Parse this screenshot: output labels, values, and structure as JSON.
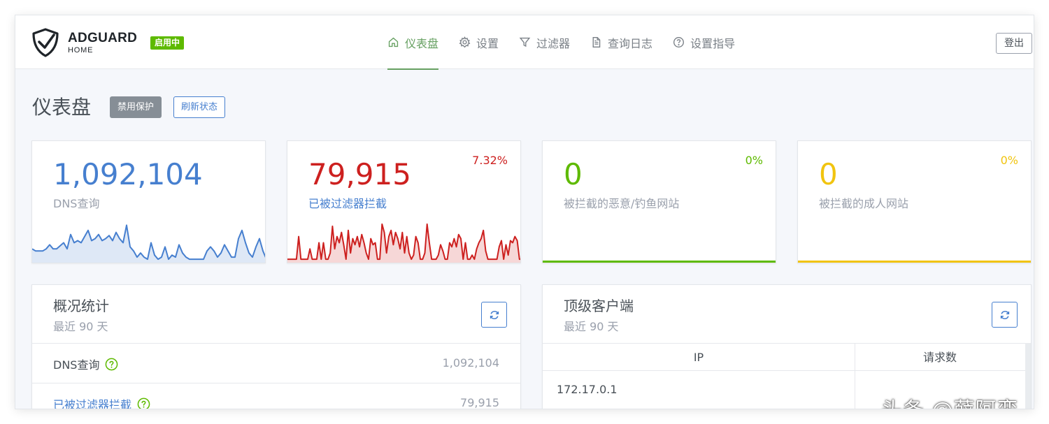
{
  "header": {
    "brand_name": "ADGUARD",
    "brand_sub": "HOME",
    "status_badge": "启用中",
    "logout": "登出",
    "nav": [
      {
        "label": "仪表盘",
        "icon": "home-icon",
        "active": true
      },
      {
        "label": "设置",
        "icon": "gear-icon",
        "active": false
      },
      {
        "label": "过滤器",
        "icon": "filter-icon",
        "active": false
      },
      {
        "label": "查询日志",
        "icon": "document-icon",
        "active": false
      },
      {
        "label": "设置指导",
        "icon": "help-circle-icon",
        "active": false
      }
    ]
  },
  "page": {
    "title": "仪表盘",
    "disable_protection": "禁用保护",
    "refresh_status": "刷新状态"
  },
  "cards": [
    {
      "value": "1,092,104",
      "label": "DNS查询",
      "percent": "",
      "color": "#467fcf"
    },
    {
      "value": "79,915",
      "label": "已被过滤器拦截",
      "percent": "7.32%",
      "color": "#cd201f"
    },
    {
      "value": "0",
      "label": "被拦截的恶意/钓鱼网站",
      "percent": "0%",
      "color": "#5eba00"
    },
    {
      "value": "0",
      "label": "被拦截的成人网站",
      "percent": "0%",
      "color": "#f1c40f"
    }
  ],
  "chart_data": [
    {
      "type": "area",
      "series": [
        {
          "values": [
            12,
            10,
            10,
            10,
            12,
            16,
            12,
            12,
            15,
            18,
            12,
            26,
            18,
            20,
            18,
            24,
            30,
            20,
            22,
            26,
            20,
            22,
            25,
            20,
            28,
            22,
            18,
            35,
            14,
            10,
            4,
            8,
            4,
            2,
            18,
            6,
            2,
            4,
            14,
            2,
            6,
            4,
            16,
            8,
            4,
            2,
            2,
            2,
            2,
            2,
            10,
            14,
            10,
            4,
            8,
            16,
            10,
            4,
            4,
            22,
            30,
            18,
            8,
            4,
            14,
            22,
            10,
            2
          ]
        }
      ],
      "color": "#467fcf"
    },
    {
      "type": "area",
      "series": [
        {
          "values": [
            2,
            2,
            2,
            2,
            2,
            24,
            2,
            2,
            2,
            2,
            12,
            2,
            2,
            2,
            18,
            2,
            18,
            2,
            2,
            8,
            34,
            12,
            24,
            18,
            28,
            16,
            2,
            30,
            8,
            22,
            16,
            24,
            14,
            26,
            18,
            8,
            2,
            22,
            16,
            18,
            2,
            2,
            36,
            28,
            8,
            24,
            30,
            16,
            28,
            22,
            12,
            28,
            8,
            24,
            8,
            2,
            6,
            24,
            18,
            2,
            2,
            8,
            36,
            18,
            2,
            2,
            2,
            6,
            16,
            10,
            2,
            2,
            18,
            14,
            22,
            14,
            26,
            22,
            2,
            18,
            2,
            2,
            6,
            2,
            12,
            18,
            22,
            30,
            10,
            2,
            2,
            2,
            2,
            2,
            14,
            20,
            2,
            16,
            6,
            20,
            18,
            24,
            20,
            2,
            2
          ]
        }
      ],
      "color": "#cd201f"
    }
  ],
  "overview": {
    "title": "概况统计",
    "subtitle": "最近 90 天",
    "rows": [
      {
        "label": "DNS查询",
        "value": "1,092,104"
      },
      {
        "label": "已被过滤器拦截",
        "value": "79,915"
      }
    ]
  },
  "top_clients": {
    "title": "顶级客户端",
    "subtitle": "最近 90 天",
    "columns": [
      "IP",
      "请求数"
    ],
    "rows": [
      {
        "ip": "172.17.0.1"
      }
    ]
  },
  "watermark": "头条 @薛阿蛮"
}
